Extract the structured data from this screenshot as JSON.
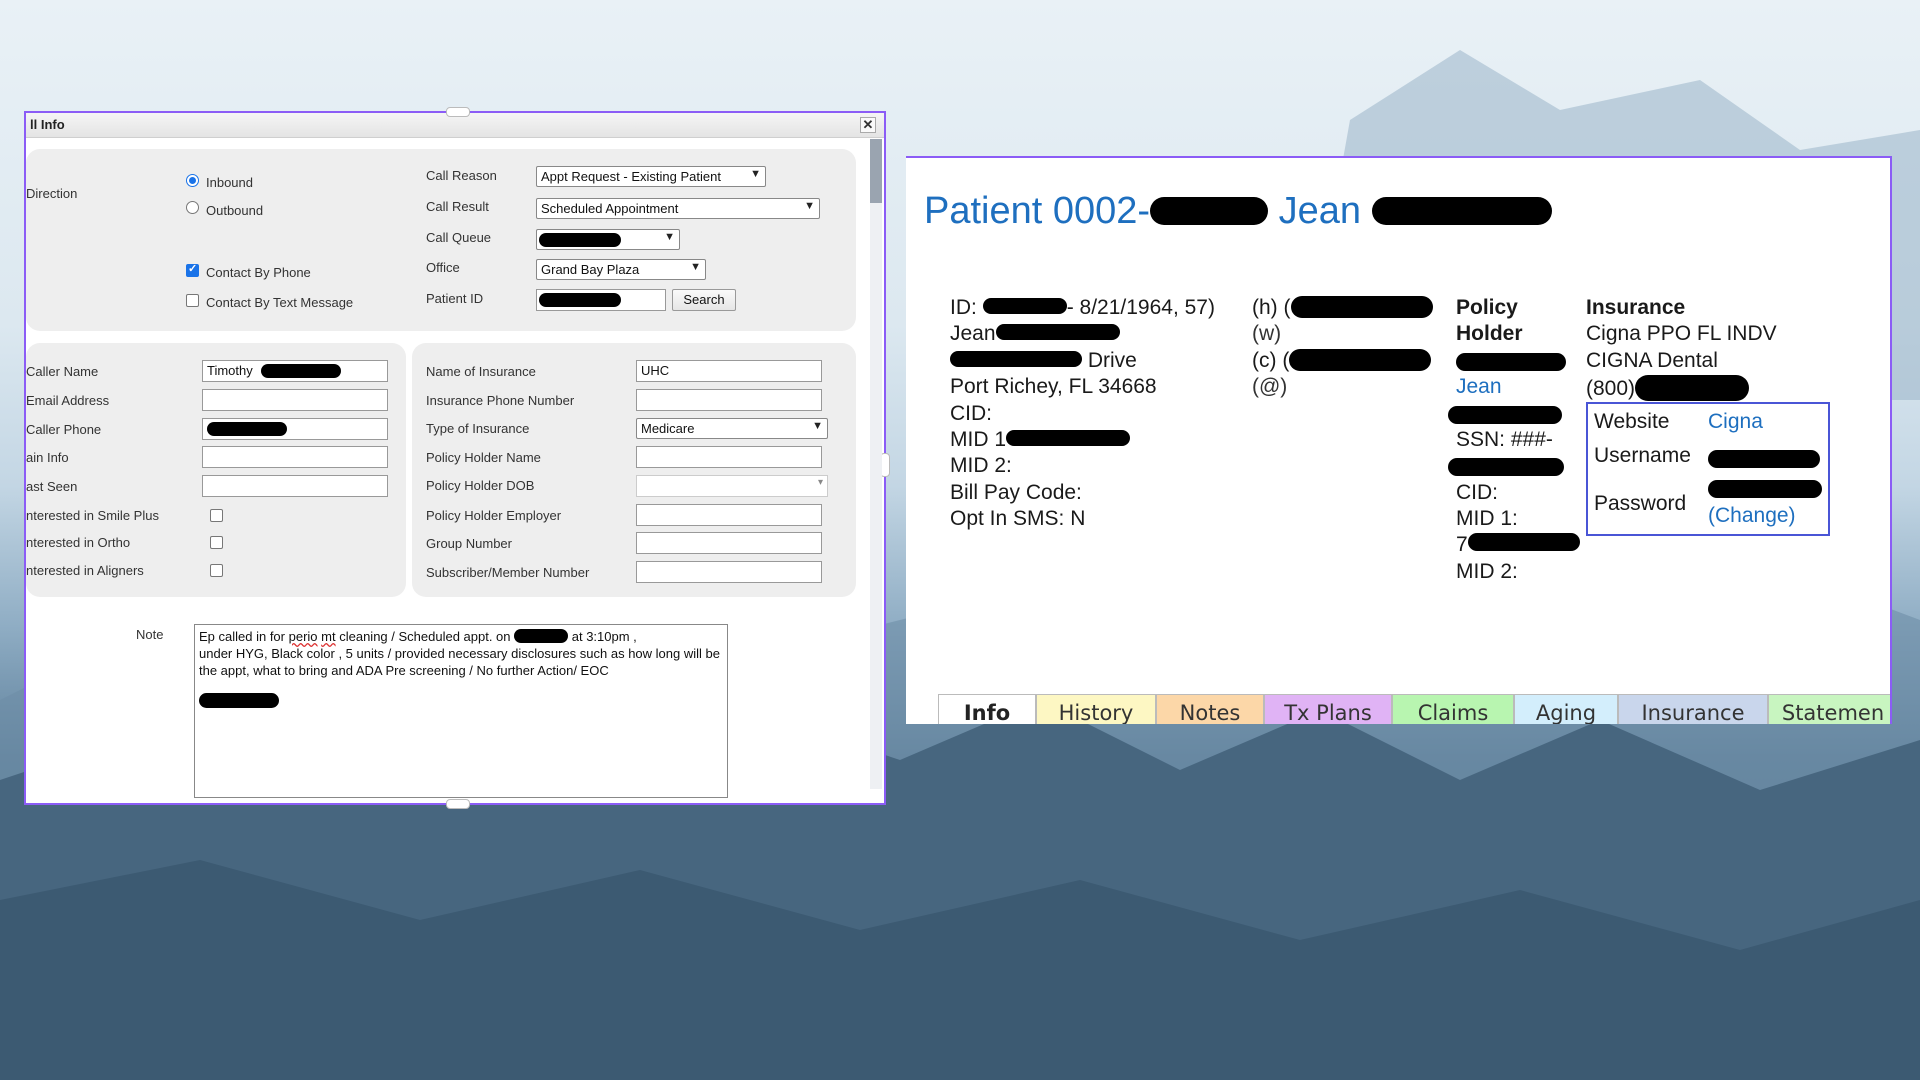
{
  "call_dialog": {
    "title": "ll Info",
    "close_label": "✕",
    "direction_label": "Direction",
    "inbound_label": "Inbound",
    "outbound_label": "Outbound",
    "contact_by_phone_label": "Contact By Phone",
    "contact_by_text_label": "Contact By Text Message",
    "call_reason_label": "Call Reason",
    "call_reason_value": "Appt Request - Existing Patient",
    "call_result_label": "Call Result",
    "call_result_value": "Scheduled Appointment",
    "call_queue_label": "Call Queue",
    "office_label": "Office",
    "office_value": "Grand Bay Plaza",
    "patient_id_label": "Patient ID",
    "search_label": "Search",
    "caller_name_label": "Caller Name",
    "caller_name_value": "Timothy",
    "email_label": "Email Address",
    "caller_phone_label": "Caller Phone",
    "pain_info_label": "ain Info",
    "last_seen_label": "ast Seen",
    "smile_plus_label": "nterested in Smile Plus",
    "ortho_label": "nterested in Ortho",
    "aligners_label": "nterested in Aligners",
    "insurance_name_label": "Name of Insurance",
    "insurance_name_value": "UHC",
    "insurance_phone_label": "Insurance Phone Number",
    "insurance_type_label": "Type of Insurance",
    "insurance_type_value": "Medicare",
    "policy_holder_name_label": "Policy Holder Name",
    "policy_holder_dob_label": "Policy Holder DOB",
    "policy_holder_employer_label": "Policy Holder Employer",
    "group_number_label": "Group Number",
    "subscriber_label": "Subscriber/Member Number",
    "note_label": "Note",
    "note_line1a": "Ep called in for ",
    "note_perio": "perio",
    "note_mt": "mt",
    "note_line1b": " cleaning  / Scheduled appt. on ",
    "note_line1c": " at 3:10pm ,",
    "note_line2": "under HYG, Black color , 5 units / provided necessary disclosures such as how long will be the appt, what to bring and ADA Pre screening / No further Action/ EOC"
  },
  "patient": {
    "title_prefix": "Patient 0002-",
    "title_first": "Jean",
    "id_label": "ID:",
    "id_dob": "- 8/21/1964, 57)",
    "first_name": "Jean",
    "street_suffix": "Drive",
    "city_line": "Port Richey, FL 34668",
    "cid": "CID:",
    "mid1": "MID 1",
    "mid2": "MID 2:",
    "bill_pay": "Bill Pay Code:",
    "opt_in": "Opt In SMS: N",
    "phone_h": "(h) (",
    "phone_w": "(w)",
    "phone_c": "(c) (",
    "phone_at": "(@)",
    "policy_holder_h1": "Policy",
    "policy_holder_h2": "Holder",
    "policy_holder_link": "Jean",
    "ssn": "SSN: ###-",
    "ph_cid": "CID:",
    "ph_mid1": "MID 1:",
    "ph_mid1_prefix": "7",
    "ph_mid2": "MID 2:",
    "insurance_header": "Insurance",
    "insurance_plan": "Cigna PPO FL INDV",
    "insurance_dental": "CIGNA Dental",
    "insurance_phone_prefix": "(800)",
    "website_label": "Website",
    "website_value": "Cigna",
    "username_label": "Username",
    "password_label": "Password",
    "change_label": "(Change)"
  },
  "tabs": [
    {
      "label": "Info",
      "color": "#ffffff"
    },
    {
      "label": "History",
      "color": "#fdf7c3"
    },
    {
      "label": "Notes",
      "color": "#fcd7a8"
    },
    {
      "label": "Tx Plans",
      "color": "#e0b3f5"
    },
    {
      "label": "Claims",
      "color": "#b8f5b0"
    },
    {
      "label": "Aging",
      "color": "#d3eefc"
    },
    {
      "label": "Insurance",
      "color": "#c9d6ec"
    },
    {
      "label": "Statemen",
      "color": "#c8f5c0"
    }
  ]
}
